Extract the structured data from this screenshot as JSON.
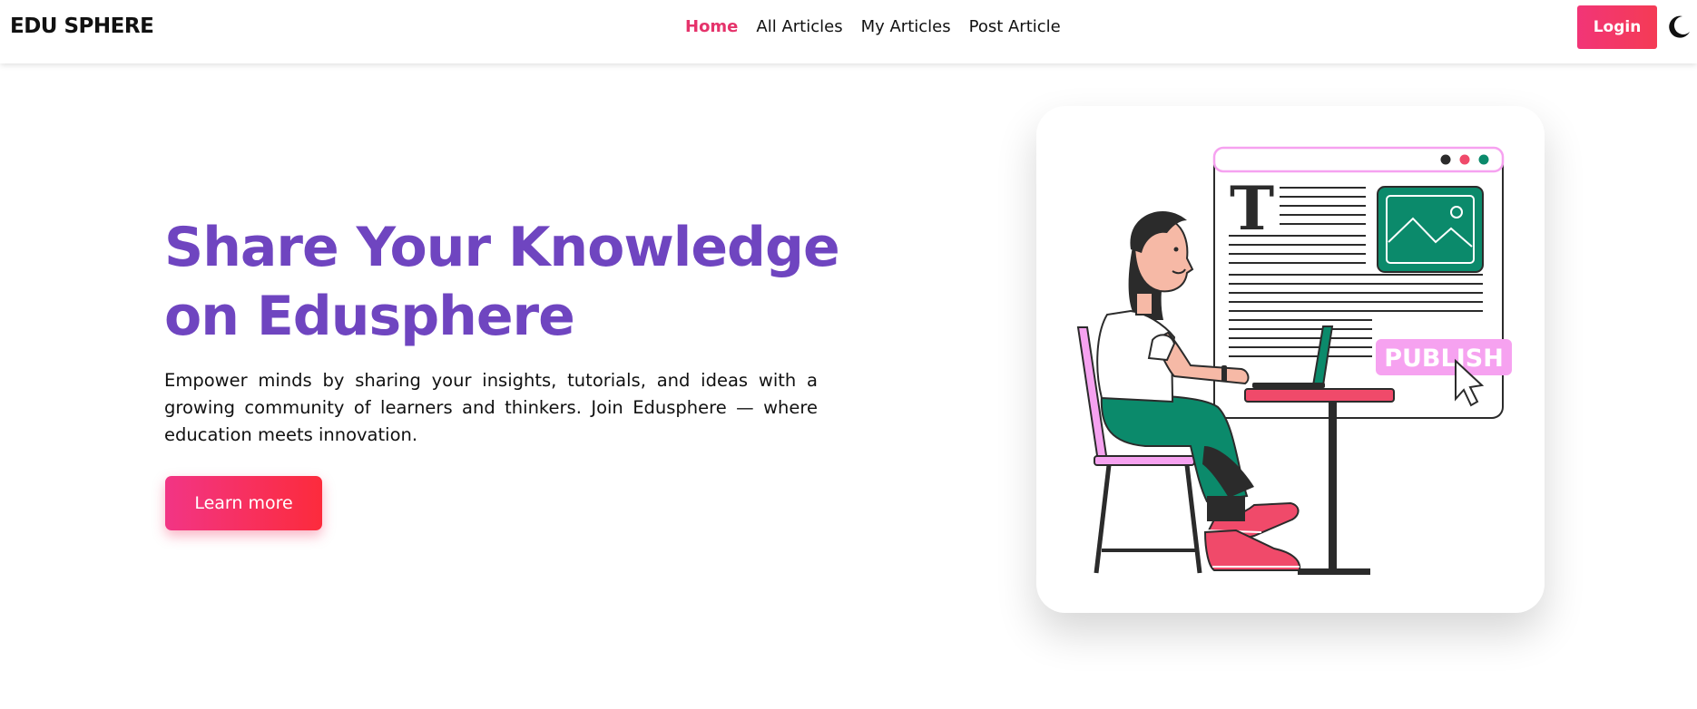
{
  "brand": {
    "name": "EDU SPHERE"
  },
  "nav": {
    "links": [
      {
        "label": "Home",
        "active": true
      },
      {
        "label": "All Articles",
        "active": false
      },
      {
        "label": "My Articles",
        "active": false
      },
      {
        "label": "Post Article",
        "active": false
      }
    ],
    "login_label": "Login",
    "theme_toggle_icon": "moon-icon"
  },
  "hero": {
    "title": "Share Your Knowledge on Edusphere",
    "description": "Empower minds by sharing your insights, tutorials, and ideas with a growing community of learners and thinkers. Join Edusphere — where education meets innovation.",
    "cta_label": "Learn more"
  },
  "illustration": {
    "publish_label": "PUBLISH",
    "letter": "T"
  },
  "colors": {
    "accent": "#e5336b",
    "title_purple": "#6f45c0",
    "pink": "#f6a2f0",
    "green": "#0b8a6b",
    "coral": "#f04a6a"
  }
}
